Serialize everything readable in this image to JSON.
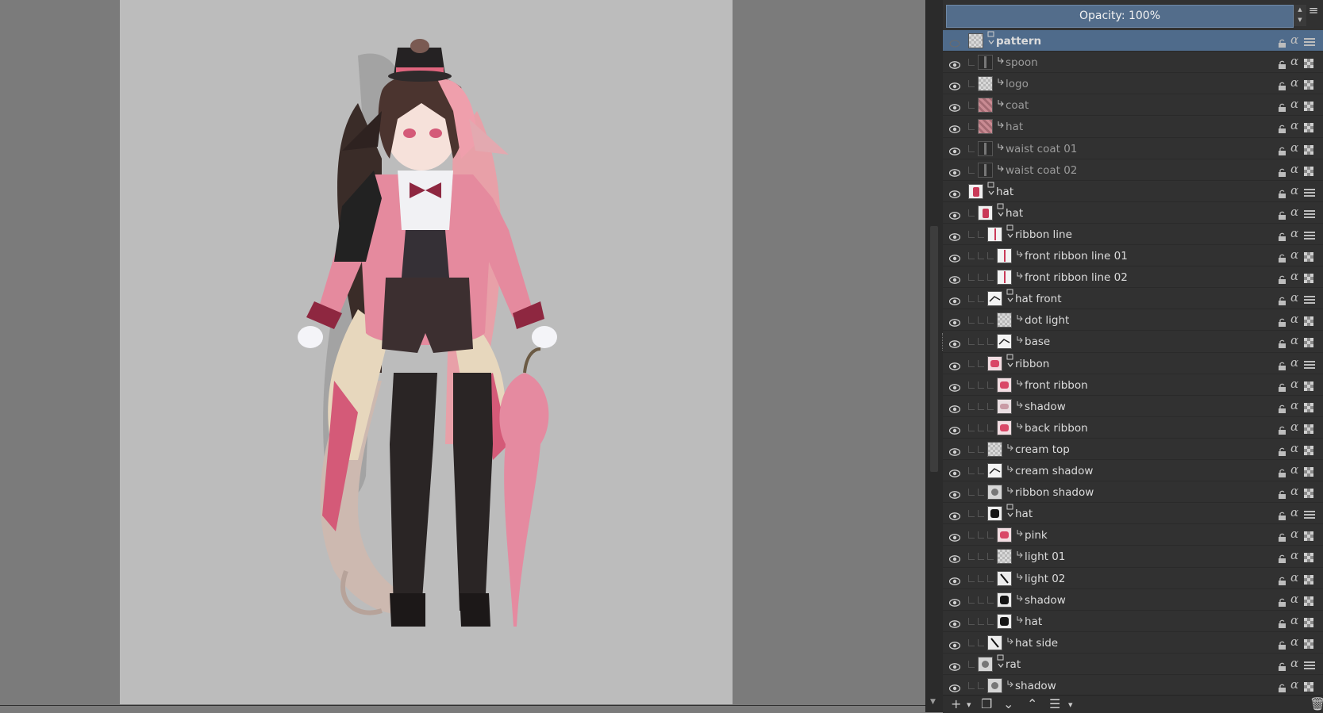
{
  "docker": {
    "opacity_label": "Opacity:  100%",
    "menu_icon": "hamburger-icon",
    "layers": [
      {
        "name": "pattern",
        "indent": 1,
        "kind": "group",
        "selected": true,
        "visible": false,
        "thumb": "pattern"
      },
      {
        "name": "spoon",
        "indent": 2,
        "kind": "clip",
        "visible": true,
        "thumb": "thin"
      },
      {
        "name": "logo",
        "indent": 2,
        "kind": "clip",
        "visible": true,
        "thumb": "pattern"
      },
      {
        "name": "coat",
        "indent": 2,
        "kind": "clip",
        "visible": true,
        "thumb": "pink-pattern"
      },
      {
        "name": "hat",
        "indent": 2,
        "kind": "clip",
        "visible": true,
        "thumb": "pink-pattern"
      },
      {
        "name": "waist coat 01",
        "indent": 2,
        "kind": "clip",
        "visible": true,
        "thumb": "thin"
      },
      {
        "name": "waist coat 02",
        "indent": 2,
        "kind": "clip",
        "visible": true,
        "thumb": "thin"
      },
      {
        "name": "hat",
        "indent": 1,
        "kind": "group",
        "visible": true,
        "thumb": "figure"
      },
      {
        "name": "hat",
        "indent": 2,
        "kind": "group",
        "visible": true,
        "thumb": "figure"
      },
      {
        "name": "ribbon line",
        "indent": 3,
        "kind": "group",
        "visible": true,
        "thumb": "line"
      },
      {
        "name": "front ribbon line 01",
        "indent": 4,
        "kind": "paint",
        "visible": true,
        "thumb": "line"
      },
      {
        "name": "front ribbon line 02",
        "indent": 4,
        "kind": "paint",
        "visible": true,
        "thumb": "line"
      },
      {
        "name": "hat front",
        "indent": 3,
        "kind": "group",
        "visible": true,
        "thumb": "sketch"
      },
      {
        "name": "dot light",
        "indent": 4,
        "kind": "paint",
        "visible": true,
        "thumb": "white"
      },
      {
        "name": "base",
        "indent": 4,
        "kind": "paint",
        "visible": true,
        "thumb": "sketch"
      },
      {
        "name": "ribbon",
        "indent": 3,
        "kind": "group",
        "visible": true,
        "thumb": "pink"
      },
      {
        "name": "front ribbon",
        "indent": 4,
        "kind": "paint",
        "visible": true,
        "thumb": "pink"
      },
      {
        "name": "shadow",
        "indent": 4,
        "kind": "paint",
        "visible": true,
        "thumb": "pink-light"
      },
      {
        "name": "back ribbon",
        "indent": 4,
        "kind": "paint",
        "visible": true,
        "thumb": "pink"
      },
      {
        "name": "cream top",
        "indent": 3,
        "kind": "paint",
        "visible": true,
        "thumb": "white"
      },
      {
        "name": "cream shadow",
        "indent": 3,
        "kind": "paint",
        "visible": true,
        "thumb": "sketch"
      },
      {
        "name": "ribbon shadow",
        "indent": 3,
        "kind": "paint",
        "visible": true,
        "thumb": "grey"
      },
      {
        "name": "hat",
        "indent": 3,
        "kind": "group",
        "visible": true,
        "thumb": "dark"
      },
      {
        "name": "pink",
        "indent": 4,
        "kind": "paint",
        "visible": true,
        "thumb": "pink"
      },
      {
        "name": "light 01",
        "indent": 4,
        "kind": "paint",
        "visible": true,
        "thumb": "white"
      },
      {
        "name": "light 02",
        "indent": 4,
        "kind": "paint",
        "visible": true,
        "thumb": "line-dark"
      },
      {
        "name": "shadow",
        "indent": 4,
        "kind": "paint",
        "visible": true,
        "thumb": "dark"
      },
      {
        "name": "hat",
        "indent": 4,
        "kind": "paint",
        "visible": true,
        "thumb": "dark"
      },
      {
        "name": "hat side",
        "indent": 3,
        "kind": "paint",
        "visible": true,
        "thumb": "line-dark"
      },
      {
        "name": "rat",
        "indent": 2,
        "kind": "group",
        "visible": true,
        "thumb": "grey"
      },
      {
        "name": "shadow",
        "indent": 3,
        "kind": "paint",
        "visible": true,
        "thumb": "grey"
      }
    ],
    "toolbar": [
      {
        "icon": "add-layer-icon",
        "glyph": "+"
      },
      {
        "icon": "dropdown-arrow-icon",
        "glyph": "▾"
      },
      {
        "icon": "duplicate-layer-icon",
        "glyph": "❐"
      },
      {
        "icon": "move-down-icon",
        "glyph": "⌄"
      },
      {
        "icon": "move-up-icon",
        "glyph": "⌃"
      },
      {
        "icon": "layer-properties-icon",
        "glyph": "☰"
      },
      {
        "icon": "dropdown-arrow-icon",
        "glyph": "▾"
      },
      {
        "icon": "delete-layer-icon",
        "glyph": "🗑"
      }
    ]
  },
  "colors": {
    "selection": "#4f6b8b",
    "opacity_bar": "#536d8b",
    "docker_bg": "#313131",
    "canvas_bg": "#bcbcbc"
  }
}
